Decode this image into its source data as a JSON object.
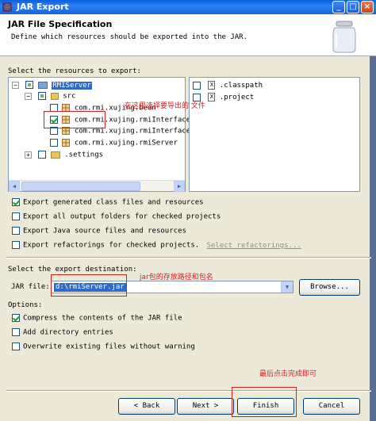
{
  "window": {
    "title": "JAR Export",
    "minimize": "_",
    "maximize": "□",
    "close": "×"
  },
  "header": {
    "title": "JAR File Specification",
    "description": "Define which resources should be exported into the JAR."
  },
  "resources": {
    "label": "Select the resources to export:",
    "tree": [
      {
        "label": "RMIServer",
        "expander": "−",
        "state": "gray"
      },
      {
        "label": "src",
        "expander": "−",
        "state": "gray"
      },
      {
        "label": "com.rmi.xujing.bean",
        "state": "unchecked"
      },
      {
        "label": "com.rmi.xujing.rmiInterface",
        "state": "checked"
      },
      {
        "label": "com.rmi.xujing.rmiInterface",
        "state": "unchecked"
      },
      {
        "label": "com.rmi.xujing.rmiServer",
        "state": "unchecked"
      },
      {
        "label": ".settings",
        "expander": "+",
        "state": "unchecked"
      }
    ],
    "files": [
      {
        "label": ".classpath",
        "state": "unchecked"
      },
      {
        "label": ".project",
        "state": "unchecked"
      }
    ]
  },
  "export_options": [
    {
      "label": "Export generated class files and resources",
      "checked": true
    },
    {
      "label": "Export all output folders for checked projects",
      "checked": false
    },
    {
      "label": "Export Java source files and resources",
      "checked": false
    },
    {
      "label": "Export refactorings for checked projects.",
      "checked": false
    }
  ],
  "select_refactorings_link": "Select refactorings...",
  "destination": {
    "label": "Select the export destination:",
    "jar_file_label": "JAR file:",
    "jar_file_value": "d:\\rmiServer.jar",
    "browse_label": "Browse..."
  },
  "options": {
    "label": "Options:",
    "items": [
      {
        "label": "Compress the contents of the JAR file",
        "checked": true
      },
      {
        "label": "Add directory entries",
        "checked": false
      },
      {
        "label": "Overwrite existing files without warning",
        "checked": false
      }
    ]
  },
  "annotations": {
    "select_files_note": "在这里选择要导出的 文件",
    "jar_path_note": "jar包的存放路径和包名",
    "finish_note": "最后点击完成即可"
  },
  "buttons": {
    "back": "< Back",
    "next": "Next >",
    "finish": "Finish",
    "cancel": "Cancel"
  },
  "colors": {
    "annotation_red": "#D62020",
    "selection_blue": "#316AC5",
    "titlebar_blue": "#0A5FDD"
  }
}
